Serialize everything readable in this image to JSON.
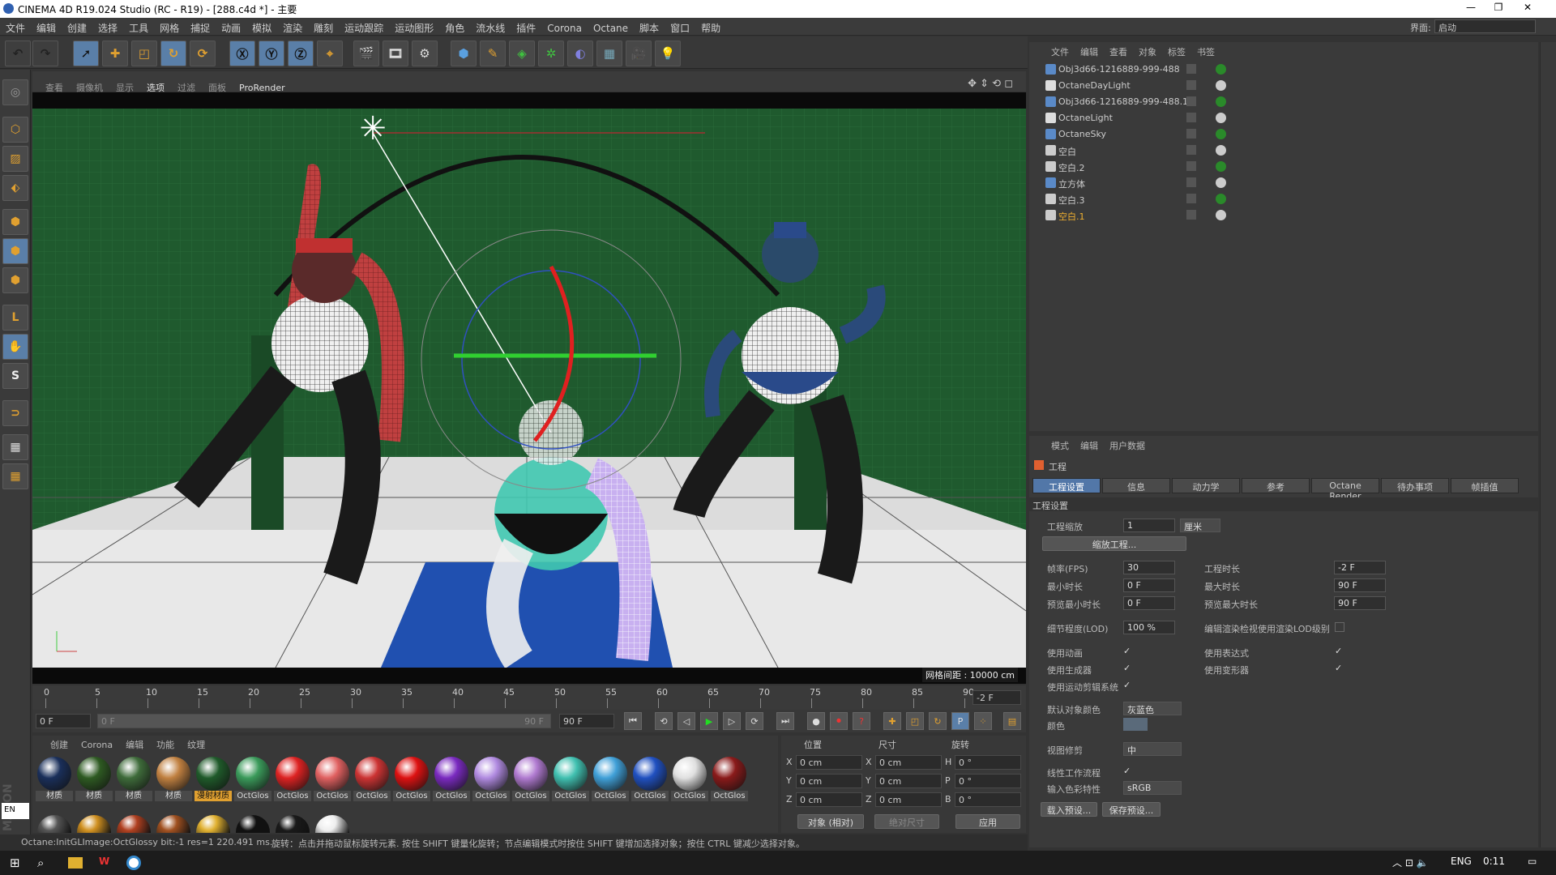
{
  "window": {
    "title": "CINEMA 4D R19.024 Studio (RC - R19) - [288.c4d *] - 主要",
    "min": "—",
    "max": "❐",
    "close": "✕"
  },
  "menu": [
    "文件",
    "编辑",
    "创建",
    "选择",
    "工具",
    "网格",
    "捕捉",
    "动画",
    "模拟",
    "渲染",
    "雕刻",
    "运动跟踪",
    "运动图形",
    "角色",
    "流水线",
    "插件",
    "Corona",
    "Octane",
    "脚本",
    "窗口",
    "帮助"
  ],
  "layout": {
    "label": "界面:",
    "value": "启动"
  },
  "viewport": {
    "menu": [
      "查看",
      "摄像机",
      "显示",
      "选项",
      "过滤",
      "面板",
      "ProRender"
    ],
    "grid_info": "网格间距 : 10000 cm"
  },
  "timeline": {
    "ticks": [
      "0",
      "5",
      "10",
      "15",
      "20",
      "25",
      "30",
      "35",
      "40",
      "45",
      "50",
      "55",
      "60",
      "65",
      "70",
      "75",
      "80",
      "85",
      "90"
    ],
    "current": "-2 F",
    "start": "0 F",
    "range_start": "0 F",
    "range_end": "90 F",
    "end": "90 F"
  },
  "materials": {
    "tabs": [
      "创建",
      "Corona",
      "编辑",
      "功能",
      "纹理"
    ],
    "row1": [
      {
        "label": "材质",
        "color": "#1a2f5a"
      },
      {
        "label": "材质",
        "color": "#2e5a22"
      },
      {
        "label": "材质",
        "color": "#3e6b3a"
      },
      {
        "label": "材质",
        "color": "#c08040"
      },
      {
        "label": "漫射材质",
        "color": "#1f5a2a"
      },
      {
        "label": "OctGlos",
        "color": "#3a9a5a"
      },
      {
        "label": "OctGlos",
        "color": "#d22"
      },
      {
        "label": "OctGlos",
        "color": "#e06060"
      },
      {
        "label": "OctGlos",
        "color": "#cc3333"
      },
      {
        "label": "OctGlos",
        "color": "#dd1111"
      },
      {
        "label": "OctGlos",
        "color": "#7a2ac0"
      },
      {
        "label": "OctGlos",
        "color": "#b08ae0"
      },
      {
        "label": "OctGlos",
        "color": "#b07ad0"
      },
      {
        "label": "OctGlos",
        "color": "#40c0b0"
      },
      {
        "label": "OctGlos",
        "color": "#40a0d8"
      },
      {
        "label": "OctGlos",
        "color": "#2050c0"
      },
      {
        "label": "OctGlos",
        "color": "#e0e0e0"
      },
      {
        "label": "OctGlos",
        "color": "#8a1a1a"
      }
    ],
    "row2": [
      "#555",
      "#d09020",
      "#b04020",
      "#a05020",
      "#e0b030",
      "#111",
      "#1a1a1a",
      "#eee"
    ]
  },
  "coords": {
    "headers": [
      "位置",
      "尺寸",
      "旋转"
    ],
    "rows": [
      {
        "a": "X",
        "pos": "0 cm",
        "b": "X",
        "size": "0 cm",
        "c": "H",
        "rot": "0 °"
      },
      {
        "a": "Y",
        "pos": "0 cm",
        "b": "Y",
        "size": "0 cm",
        "c": "P",
        "rot": "0 °"
      },
      {
        "a": "Z",
        "pos": "0 cm",
        "b": "Z",
        "size": "0 cm",
        "c": "B",
        "rot": "0 °"
      }
    ],
    "mode": "对象 (相对)",
    "size_mode": "绝对尺寸",
    "apply": "应用"
  },
  "status": {
    "left": "Octane:InitGLImage:OctGlossy  bit:-1 res=1  220.491 ms.",
    "right": "旋转：点击并拖动鼠标旋转元素. 按住 SHIFT 键量化旋转；节点编辑模式时按住 SHIFT 键增加选择对象；按住 CTRL 键减少选择对象。"
  },
  "objects": {
    "menu": [
      "文件",
      "编辑",
      "查看",
      "对象",
      "标签",
      "书签"
    ],
    "items": [
      {
        "name": "Obj3d66-1216889-999-488",
        "color": "#5a8ac8",
        "hl": false
      },
      {
        "name": "OctaneDayLight",
        "color": "#ddd",
        "hl": false
      },
      {
        "name": "Obj3d66-1216889-999-488.1",
        "color": "#5a8ac8",
        "hl": false
      },
      {
        "name": "OctaneLight",
        "color": "#ddd",
        "hl": false
      },
      {
        "name": "OctaneSky",
        "color": "#5a8ac8",
        "hl": false
      },
      {
        "name": "空白",
        "color": "#ccc",
        "hl": false
      },
      {
        "name": "空白.2",
        "color": "#ccc",
        "hl": false
      },
      {
        "name": "立方体",
        "color": "#5a8ac8",
        "hl": false
      },
      {
        "name": "空白.3",
        "color": "#ccc",
        "hl": false
      },
      {
        "name": "空白.1",
        "color": "#ccc",
        "hl": true
      }
    ]
  },
  "attributes": {
    "menu": [
      "模式",
      "编辑",
      "用户数据"
    ],
    "object": "工程",
    "tabs": [
      "工程设置",
      "信息",
      "动力学",
      "参考",
      "Octane Render",
      "待办事项",
      "帧插值"
    ],
    "section": "工程设置",
    "scale_label": "工程缩放",
    "scale_value": "1",
    "scale_unit": "厘米",
    "scale_btn": "缩放工程...",
    "fps_label": "帧率(FPS)",
    "fps": "30",
    "proj_len_label": "工程时长",
    "proj_len": "-2 F",
    "min_label": "最小时长",
    "min": "0 F",
    "max_label": "最大时长",
    "max": "90 F",
    "pmin_label": "预览最小时长",
    "pmin": "0 F",
    "pmax_label": "预览最大时长",
    "pmax": "90 F",
    "lod_label": "细节程度(LOD)",
    "lod": "100 %",
    "lod_render_label": "编辑渲染检视使用渲染LOD级别",
    "anim_label": "使用动画",
    "expr_label": "使用表达式",
    "gen_label": "使用生成器",
    "deform_label": "使用变形器",
    "mograph_label": "使用运动剪辑系统",
    "defcolor_label": "默认对象颜色",
    "defcolor": "灰蓝色",
    "color_label": "颜色",
    "clip_label": "视图修剪",
    "clip": "中",
    "linear_label": "线性工作流程",
    "inputcolor_label": "输入色彩特性",
    "inputcolor": "sRGB",
    "load_preset": "载入预设...",
    "save_preset": "保存预设..."
  },
  "taskbar": {
    "ime": "ENG",
    "time": "0:11",
    "lang": "EN"
  }
}
